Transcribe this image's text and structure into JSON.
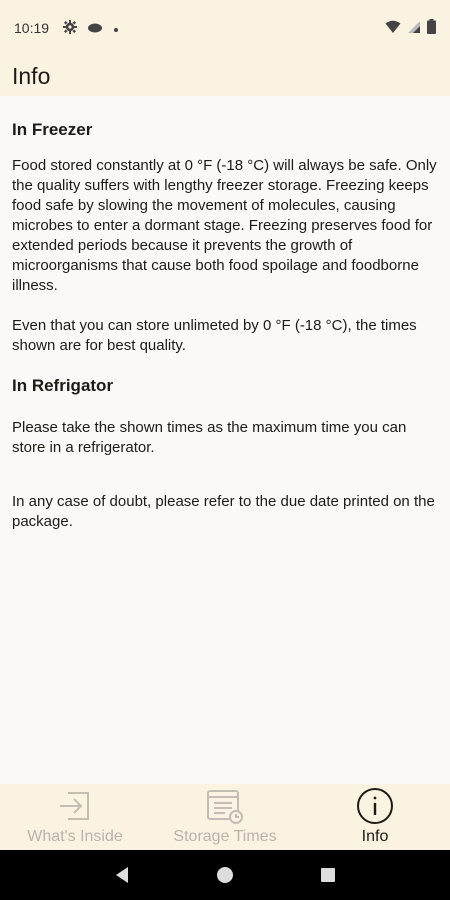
{
  "status_bar": {
    "time": "10:19",
    "left_icons": [
      "gear-icon",
      "cloud-icon",
      "dot-icon"
    ],
    "right_icons": [
      "wifi-icon",
      "signal-icon",
      "battery-icon"
    ]
  },
  "app_bar": {
    "title": "Info"
  },
  "content": {
    "freezer_heading": "In Freezer",
    "freezer_para_1": "Food stored constantly at 0 °F (-18 °C) will always be safe. Only the quality suffers with lengthy freezer storage. Freezing keeps food safe by slowing the movement of molecules, causing microbes to enter a dormant stage. Freezing preserves food for extended periods because it prevents the growth of microorganisms that cause both food spoilage and foodborne illness.",
    "freezer_para_2": "Even that you can store unlimeted by 0 °F (-18 °C), the times shown are for best quality.",
    "refrigator_heading": "In Refrigator",
    "refrigator_para": "Please take the shown times as the maximum time you can store in a refrigerator.",
    "doubt_para": "In any case of doubt, please refer to the due date printed on the package."
  },
  "bottom_nav": {
    "items": [
      {
        "label": "What's Inside",
        "icon": "login-arrow-icon",
        "active": false
      },
      {
        "label": "Storage Times",
        "icon": "calendar-clock-icon",
        "active": false
      },
      {
        "label": "Info",
        "icon": "info-icon",
        "active": true
      }
    ]
  },
  "colors": {
    "bar_background": "#fbf3e2",
    "content_background": "#faf9f7",
    "inactive_label": "#b8b4ab",
    "active_label": "#1d1b16"
  }
}
